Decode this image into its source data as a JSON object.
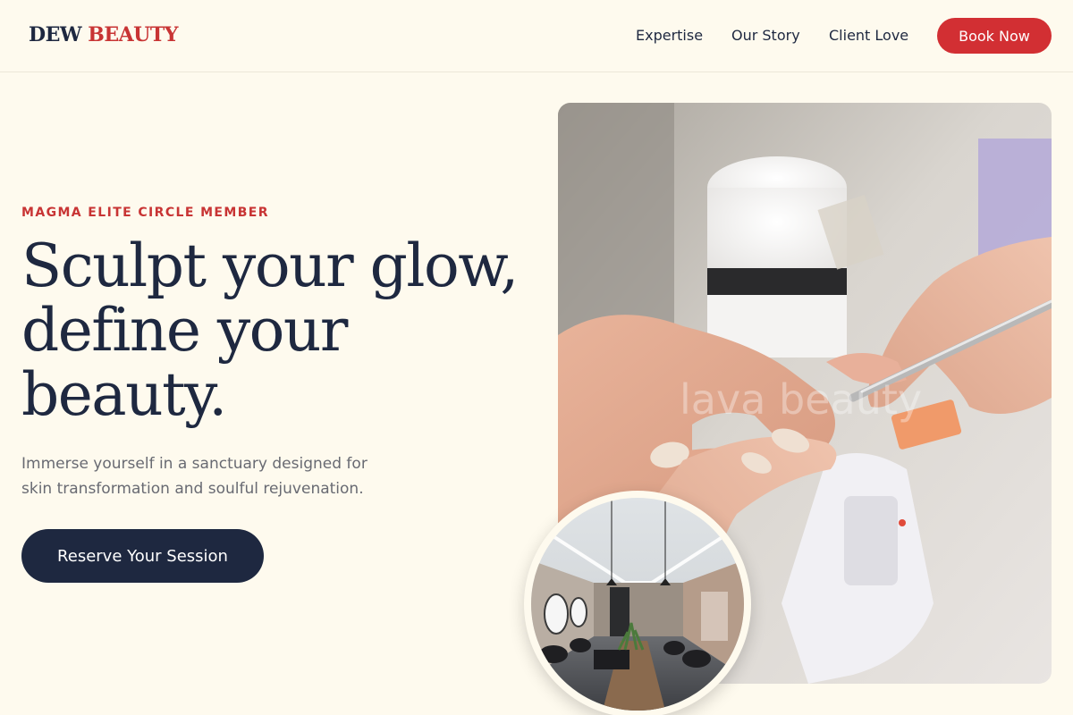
{
  "header": {
    "logo_part1": "DEW",
    "logo_part2": "BEAUTY",
    "nav": [
      "Expertise",
      "Our Story",
      "Client Love"
    ],
    "cta_label": "Book Now"
  },
  "hero": {
    "eyebrow": "MAGMA ELITE CIRCLE MEMBER",
    "headline_lines": [
      "Sculpt your glow,",
      "define your",
      "beauty."
    ],
    "subtext_lines": [
      "Immerse yourself in a sanctuary designed for",
      "skin transformation and soulful rejuvenation."
    ],
    "cta_label": "Reserve Your Session",
    "image_watermark": "lava beauty"
  },
  "colors": {
    "background": "#fefaee",
    "navy": "#1e2840",
    "accent_red": "#d22f33",
    "muted_text": "#686a72"
  }
}
